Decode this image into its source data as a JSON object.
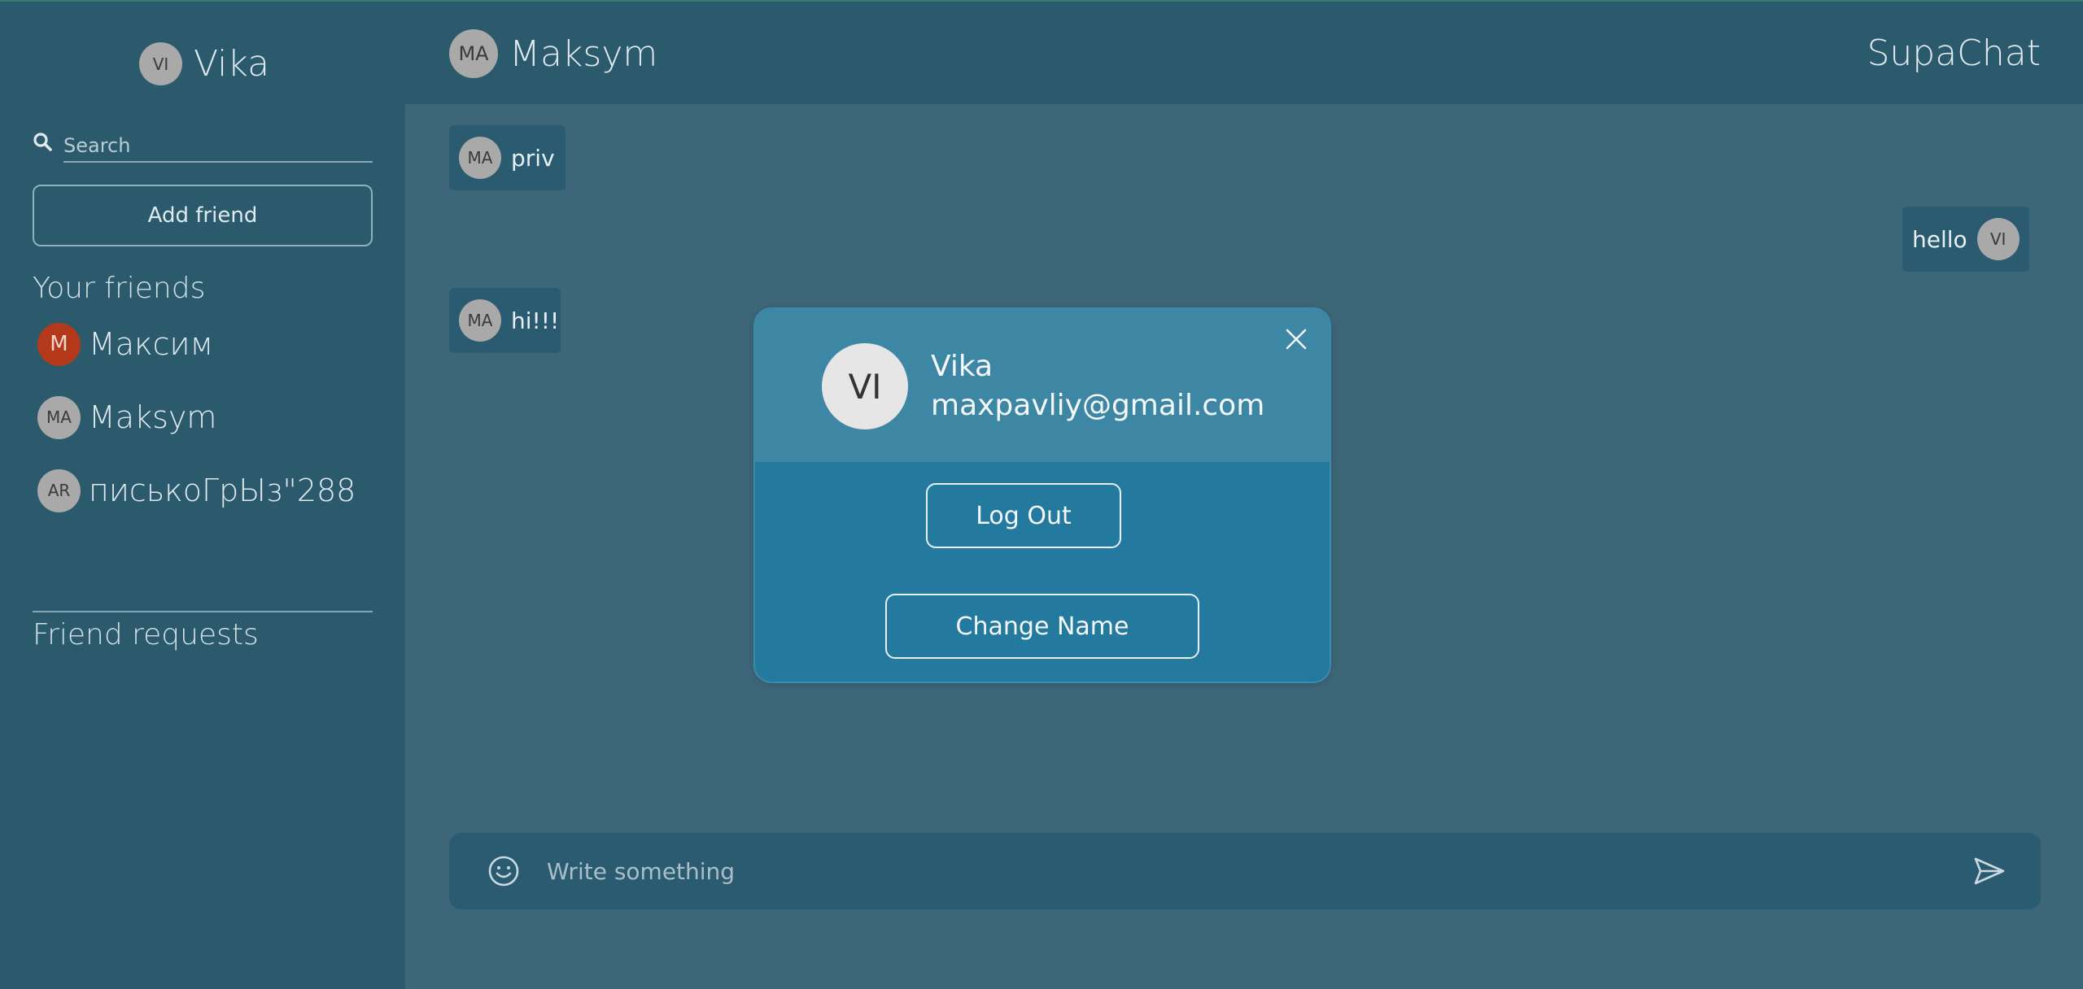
{
  "sidebar": {
    "current_user": {
      "initials": "VI",
      "name": "Vika"
    },
    "search": {
      "placeholder": "Search"
    },
    "add_friend_label": "Add friend",
    "friends_title": "Your friends",
    "friends": [
      {
        "initials": "M",
        "name": "Максим",
        "avatar_color": "#b3391a"
      },
      {
        "initials": "MA",
        "name": "Maksym"
      },
      {
        "initials": "AR",
        "name": "писькоГрЫз\"288"
      }
    ],
    "requests_title": "Friend requests"
  },
  "header": {
    "contact": {
      "initials": "MA",
      "name": "Maksym"
    },
    "brand": "SupaChat"
  },
  "messages": [
    {
      "initials": "MA",
      "text": "priv",
      "side": "left"
    },
    {
      "initials": "VI",
      "text": "hello",
      "side": "right"
    },
    {
      "initials": "MA",
      "text": "hi!!!",
      "side": "left"
    }
  ],
  "composer": {
    "placeholder": "Write something"
  },
  "modal": {
    "initials": "VI",
    "name": "Vika",
    "email": "maxpavliy@gmail.com",
    "logout_label": "Log Out",
    "change_name_label": "Change Name"
  },
  "colors": {
    "sidebar_bg": "#2b5a6d",
    "chat_bg": "#3d6779",
    "bubble_bg": "#2a5b70",
    "modal_body": "#247a9e",
    "modal_head": "#3d87a5"
  }
}
